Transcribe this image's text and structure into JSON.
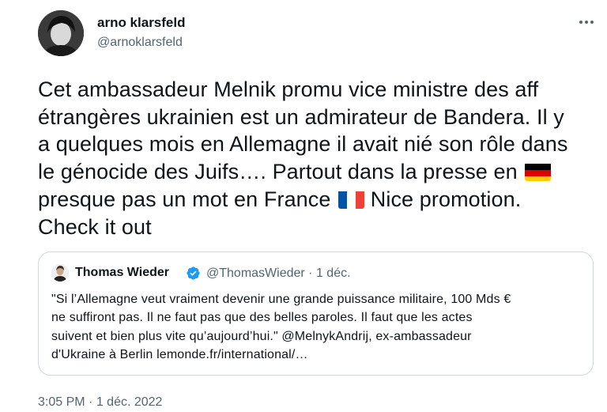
{
  "author": {
    "name": "arno klarsfeld",
    "handle": "@arnoklarsfeld"
  },
  "tweet": {
    "lines": [
      "Cet ambassadeur Melnik promu vice ministre des aff",
      "étrangères ukrainien est un admirateur de Bandera. Il y",
      "a quelques mois en Allemagne il avait nié son rôle dans",
      "le génocide des Juifs…. Partout dans la presse en",
      "presque pas un mot en France",
      "Nice  promotion.",
      "Check it out"
    ],
    "flags": [
      "germany-flag",
      "france-flag"
    ]
  },
  "quote": {
    "name": "Thomas Wieder",
    "handle": "@ThomasWieder",
    "separator": "·",
    "date": "1 déc.",
    "lines": [
      "\"Si l’Allemagne veut vraiment devenir une grande puissance militaire, 100 Mds €",
      "ne suffiront pas. Il ne faut pas que des belles paroles. Il faut que les actes",
      "suivent et bien plus vite qu’aujourd’hui.\" @MelnykAndrij, ex-ambassadeur",
      "d'Ukraine à Berlin  lemonde.fr/international/…"
    ]
  },
  "timestamp": {
    "time": "3:05 PM",
    "separator": "·",
    "date": "1 déc. 2022"
  },
  "colors": {
    "text": "#0f1419",
    "secondary": "#536471",
    "border": "#cfd9de",
    "verified": "#1d9bf0"
  }
}
